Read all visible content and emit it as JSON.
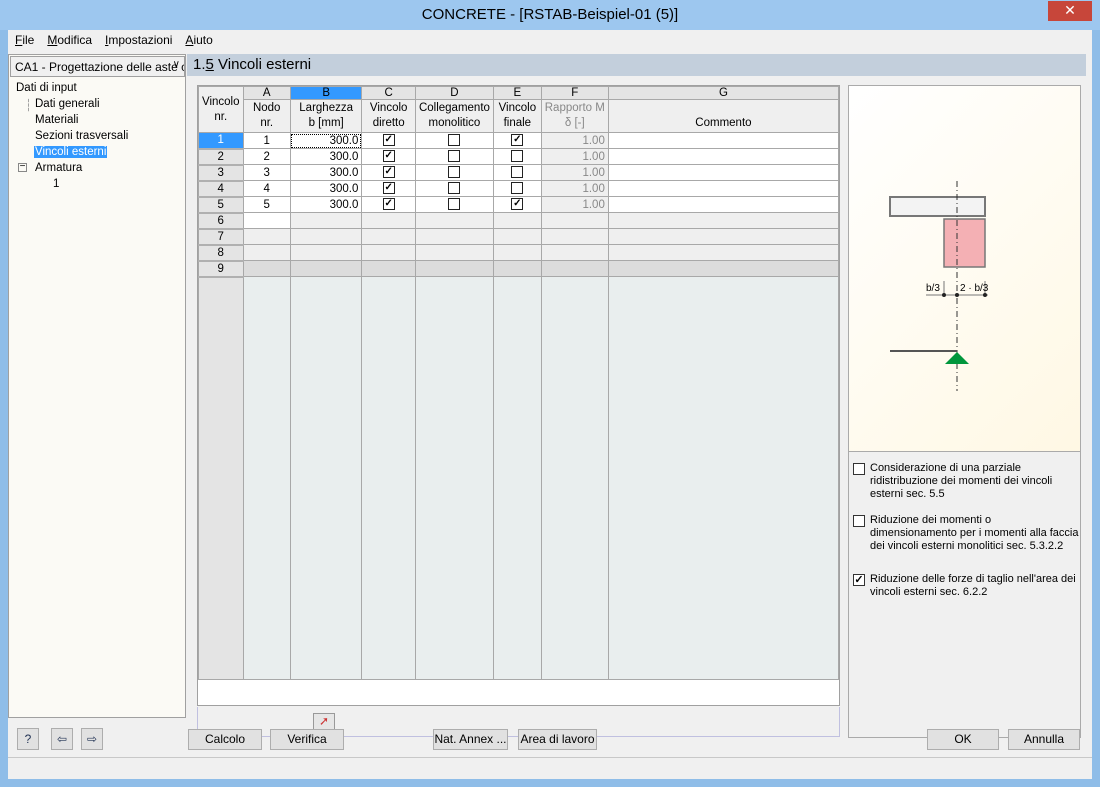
{
  "window": {
    "title": "CONCRETE - [RSTAB-Beispiel-01 (5)]",
    "close": "✕"
  },
  "menu": [
    {
      "u": "F",
      "rest": "ile"
    },
    {
      "u": "M",
      "rest": "odifica"
    },
    {
      "u": "I",
      "rest": "mpostazioni"
    },
    {
      "u": "A",
      "rest": "iuto"
    }
  ],
  "combo": {
    "value": "CA1 - Progettazione delle aste c"
  },
  "tree": {
    "root": "Dati di input",
    "items": [
      "Dati generali",
      "Materiali",
      "Sezioni trasversali",
      "Vincoli esterni"
    ],
    "selected": "Vincoli esterni",
    "armatura": "Armatura",
    "armatura_child": "1"
  },
  "section": {
    "num": "1.",
    "num_u": "5",
    "title": " Vincoli esterni"
  },
  "table": {
    "letters": [
      "A",
      "B",
      "C",
      "D",
      "E",
      "F",
      "G"
    ],
    "headers": [
      [
        "Vincolo",
        "nr."
      ],
      [
        "Nodo",
        "nr."
      ],
      [
        "Larghezza",
        "b [mm]"
      ],
      [
        "Vincolo",
        "diretto"
      ],
      [
        "Collegamento",
        "monolitico"
      ],
      [
        "Vincolo",
        "finale"
      ],
      [
        "Rapporto M",
        "δ [-]"
      ],
      [
        "",
        "Commento"
      ]
    ],
    "rows": [
      {
        "n": "1",
        "node": "1",
        "b": "300.0",
        "diretto": true,
        "mono": false,
        "finale": true,
        "ratio": "1.00",
        "comment": ""
      },
      {
        "n": "2",
        "node": "2",
        "b": "300.0",
        "diretto": true,
        "mono": false,
        "finale": false,
        "ratio": "1.00",
        "comment": ""
      },
      {
        "n": "3",
        "node": "3",
        "b": "300.0",
        "diretto": true,
        "mono": false,
        "finale": false,
        "ratio": "1.00",
        "comment": ""
      },
      {
        "n": "4",
        "node": "4",
        "b": "300.0",
        "diretto": true,
        "mono": false,
        "finale": false,
        "ratio": "1.00",
        "comment": ""
      },
      {
        "n": "5",
        "node": "5",
        "b": "300.0",
        "diretto": true,
        "mono": false,
        "finale": true,
        "ratio": "1.00",
        "comment": ""
      }
    ],
    "empty_rows": [
      "6",
      "7",
      "8",
      "9"
    ]
  },
  "diagram": {
    "label_left": "b/3",
    "label_right": "2 · b/3",
    "colors": {
      "column": "#f4b0b4",
      "support": "#00963c"
    }
  },
  "options": [
    {
      "checked": false,
      "text": "Considerazione di una parziale ridistribuzione dei momenti dei vincoli esterni sec. 5.5"
    },
    {
      "checked": false,
      "text": "Riduzione dei momenti o dimensionamento per i momenti alla faccia dei vincoli esterni monolitici sec. 5.3.2.2"
    },
    {
      "checked": true,
      "text": "Riduzione delle forze di taglio nell'area dei vincoli esterni sec. 6.2.2"
    }
  ],
  "buttons": {
    "calcolo": "Calcolo",
    "verifica": "Verifica",
    "natannex": "Nat. Annex ...",
    "area": "Area di lavoro",
    "ok": "OK",
    "annulla": "Annulla"
  },
  "status": ""
}
